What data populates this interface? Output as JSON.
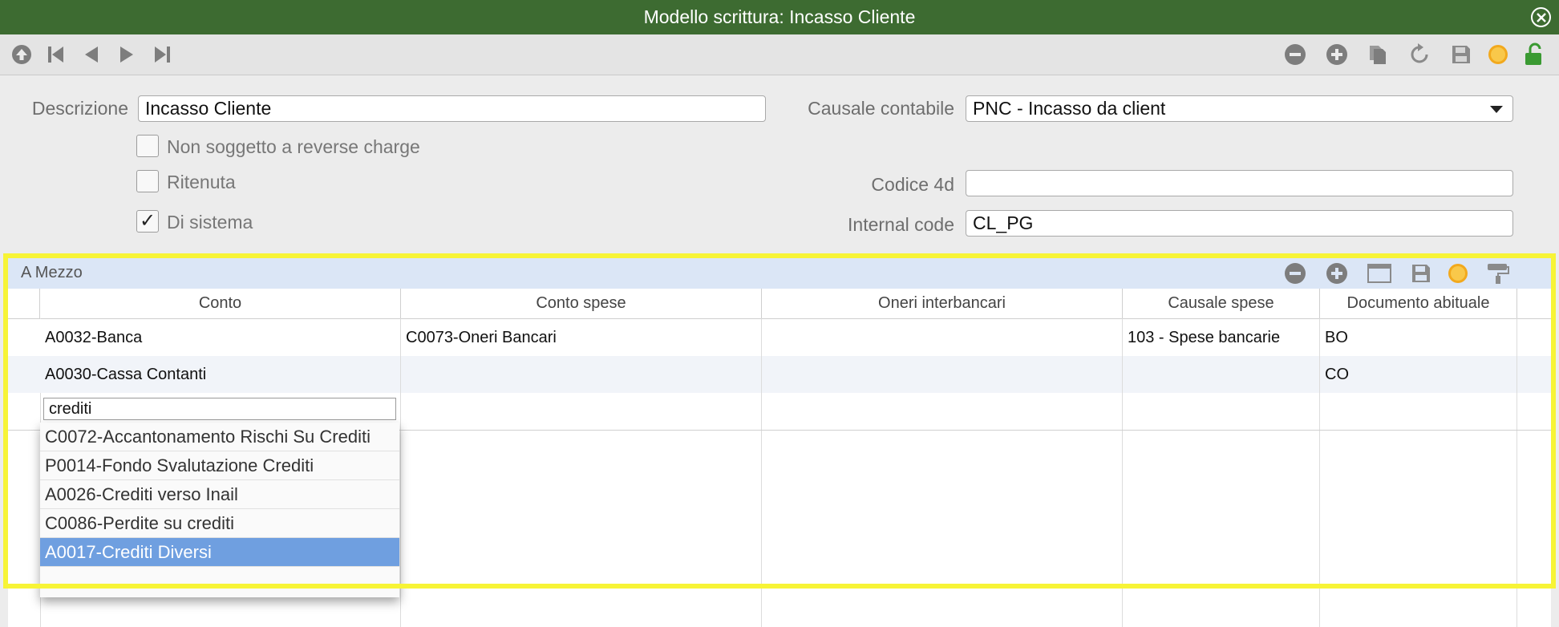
{
  "window": {
    "title": "Modello scrittura: Incasso Cliente"
  },
  "toolbar": {
    "nav_icons": [
      "up-circle-icon",
      "first-record-icon",
      "previous-record-icon",
      "next-record-icon",
      "last-record-icon"
    ],
    "action_icons": [
      "delete-record-icon",
      "add-record-icon",
      "duplicate-icon",
      "revert-icon",
      "save-icon",
      "status-dot-icon",
      "unlock-icon"
    ]
  },
  "form": {
    "descrizione_label": "Descrizione",
    "descrizione_value": "Incasso Cliente",
    "causale_label": "Causale contabile",
    "causale_value": "PNC - Incasso da client",
    "checkbox_reverse_label": "Non soggetto a reverse charge",
    "checkbox_reverse_checked": false,
    "checkbox_ritenuta_label": "Ritenuta",
    "checkbox_ritenuta_checked": false,
    "checkbox_sistema_label": "Di sistema",
    "checkbox_sistema_checked": true,
    "checkmark": "✓",
    "codice4d_label": "Codice 4d",
    "codice4d_value": "",
    "internal_code_label": "Internal code",
    "internal_code_value": "CL_PG"
  },
  "panel": {
    "title": "A Mezzo",
    "columns": [
      "Conto",
      "Conto spese",
      "Oneri interbancari",
      "Causale spese",
      "Documento abituale"
    ],
    "rows": [
      [
        "A0032-Banca",
        "C0073-Oneri Bancari",
        "",
        "103 - Spese bancarie",
        "BO"
      ],
      [
        "A0030-Cassa Contanti",
        "",
        "",
        "",
        "CO"
      ]
    ],
    "edit_value": "crediti",
    "dropdown": [
      "C0072-Accantonamento Rischi Su Crediti",
      "P0014-Fondo Svalutazione Crediti",
      "A0026-Crediti verso Inail",
      "C0086-Perdite su crediti",
      "A0017-Crediti Diversi"
    ],
    "dropdown_selected_index": 4
  },
  "colors": {
    "titlebar": "#3d6b31",
    "highlight": "#f7f436",
    "panel_header": "#dbe6f6",
    "dropdown_selected": "#6f9fe0"
  }
}
